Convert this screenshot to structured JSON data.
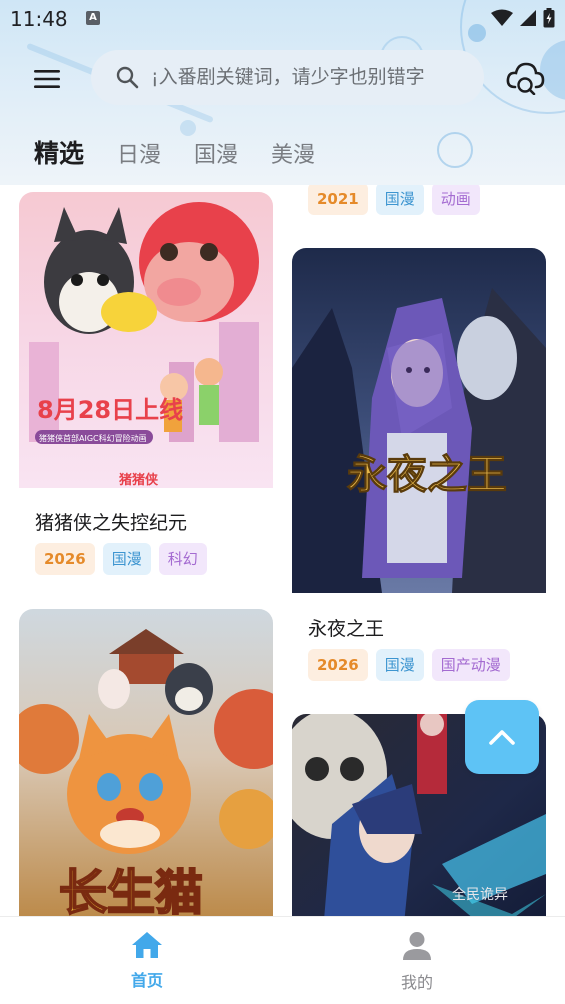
{
  "status": {
    "time": "11:48",
    "badge": "A"
  },
  "search": {
    "placeholder": "¡入番剧关键词，请少字也别错字"
  },
  "tabs": [
    {
      "label": "精选",
      "active": true
    },
    {
      "label": "日漫",
      "active": false
    },
    {
      "label": "国漫",
      "active": false
    },
    {
      "label": "美漫",
      "active": false
    }
  ],
  "cards": [
    {
      "title": "",
      "tags": [
        "2021",
        "国漫",
        "动画"
      ]
    },
    {
      "title": "猪猪侠之失控纪元",
      "tags": [
        "2026",
        "国漫",
        "科幻"
      ],
      "poster_text": [
        "8月28日上线",
        "猪猪侠首部AIGC科幻冒险动画",
        "猪猪侠"
      ]
    },
    {
      "title": "永夜之王",
      "tags": [
        "2026",
        "国漫",
        "国产动漫"
      ],
      "poster_text": [
        "永夜之王"
      ]
    },
    {
      "title": "",
      "tags": [],
      "poster_text": [
        "长生猫"
      ]
    },
    {
      "title": "",
      "tags": [],
      "poster_text": [
        "全民诡异"
      ]
    }
  ],
  "nav": [
    {
      "label": "首页",
      "active": true,
      "icon": "home-icon"
    },
    {
      "label": "我的",
      "active": false,
      "icon": "user-icon"
    }
  ],
  "colors": {
    "accent": "#42a8ea",
    "fab": "#5ec3f5",
    "year_tag": "#e58a2a",
    "region_tag": "#3d95d0",
    "genre_tag": "#a46bd1"
  }
}
